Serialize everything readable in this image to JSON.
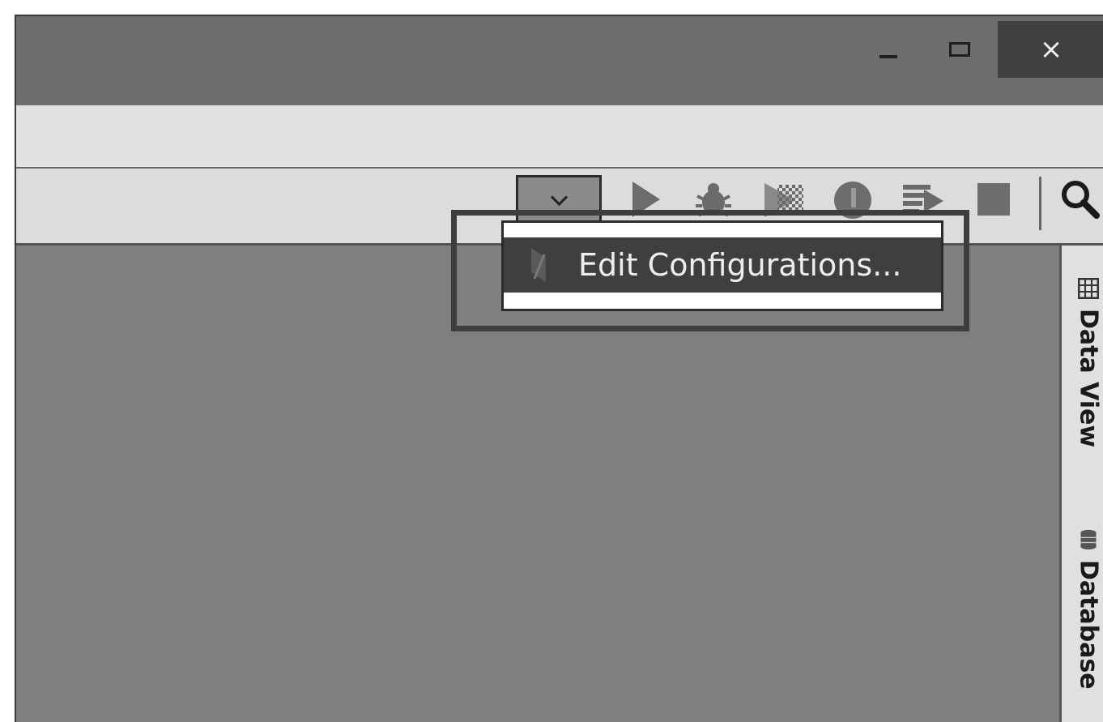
{
  "window": {
    "controls": {
      "minimize": "minimize-icon",
      "maximize": "maximize-icon",
      "close_glyph": "×"
    }
  },
  "toolbar": {
    "run_config_dropdown": "chevron-down-icon",
    "icons": [
      "run-icon",
      "debug-icon",
      "run-with-coverage-icon",
      "profile-icon",
      "concurrency-diagram-icon",
      "stop-icon",
      "search-icon"
    ]
  },
  "popup_menu": {
    "items": [
      {
        "label": "Edit Configurations...",
        "icon": "edit-configurations-icon"
      }
    ]
  },
  "right_sidebar": {
    "tabs": [
      {
        "label": "Data View",
        "icon": "table-grid-icon"
      },
      {
        "label": "Database",
        "icon": "database-icon"
      }
    ]
  },
  "colors": {
    "titlebar": "#6e6e6e",
    "close_button": "#404040",
    "toolbar": "#dcdcdc",
    "editor": "#7f7f7f",
    "menu_selected": "#3f3f3f"
  }
}
